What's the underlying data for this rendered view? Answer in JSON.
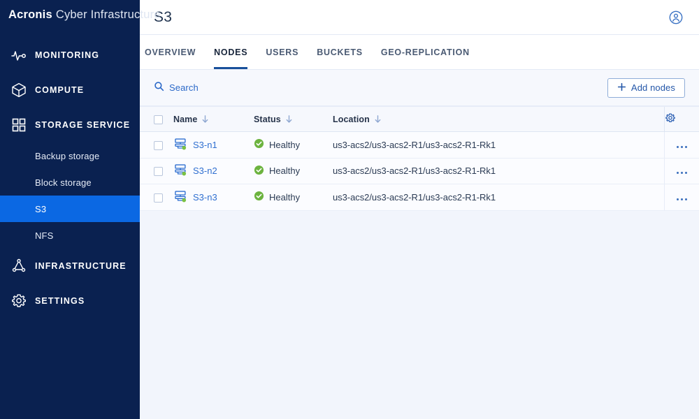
{
  "sidebar": {
    "logo": {
      "strong": "Acronis",
      "light": "Cyber Infrastructure"
    },
    "items": [
      {
        "label": "MONITORING",
        "icon": "pulse-icon"
      },
      {
        "label": "COMPUTE",
        "icon": "cube-icon"
      },
      {
        "label": "STORAGE SERVICE",
        "icon": "grid-icon"
      },
      {
        "label": "INFRASTRUCTURE",
        "icon": "triangle-nodes-icon"
      },
      {
        "label": "SETTINGS",
        "icon": "gear-icon"
      }
    ],
    "storage_children": [
      {
        "label": "Backup storage",
        "active": false
      },
      {
        "label": "Block storage",
        "active": false
      },
      {
        "label": "S3",
        "active": true
      },
      {
        "label": "NFS",
        "active": false
      }
    ],
    "active_color": "#0b68e3",
    "background_color": "#0a2150"
  },
  "header": {
    "title": "S3",
    "avatar_icon": "user-account-icon"
  },
  "tabs": [
    {
      "label": "OVERVIEW",
      "active": false
    },
    {
      "label": "NODES",
      "active": true
    },
    {
      "label": "USERS",
      "active": false
    },
    {
      "label": "BUCKETS",
      "active": false
    },
    {
      "label": "GEO-REPLICATION",
      "active": false
    }
  ],
  "toolbar": {
    "search_label": "Search",
    "search_icon": "search-icon",
    "add_nodes_label": "Add nodes",
    "add_icon": "plus-icon"
  },
  "table": {
    "columns": [
      "Name",
      "Status",
      "Location"
    ],
    "settings_icon": "gear-icon",
    "rows": [
      {
        "name": "S3-n1",
        "status": "Healthy",
        "location": "us3-acs2/us3-acs2-R1/us3-acs2-R1-Rk1"
      },
      {
        "name": "S3-n2",
        "status": "Healthy",
        "location": "us3-acs2/us3-acs2-R1/us3-acs2-R1-Rk1"
      },
      {
        "name": "S3-n3",
        "status": "Healthy",
        "location": "us3-acs2/us3-acs2-R1/us3-acs2-R1-Rk1"
      }
    ],
    "status_color": "#6cb33f",
    "link_color": "#2f6fd0"
  }
}
